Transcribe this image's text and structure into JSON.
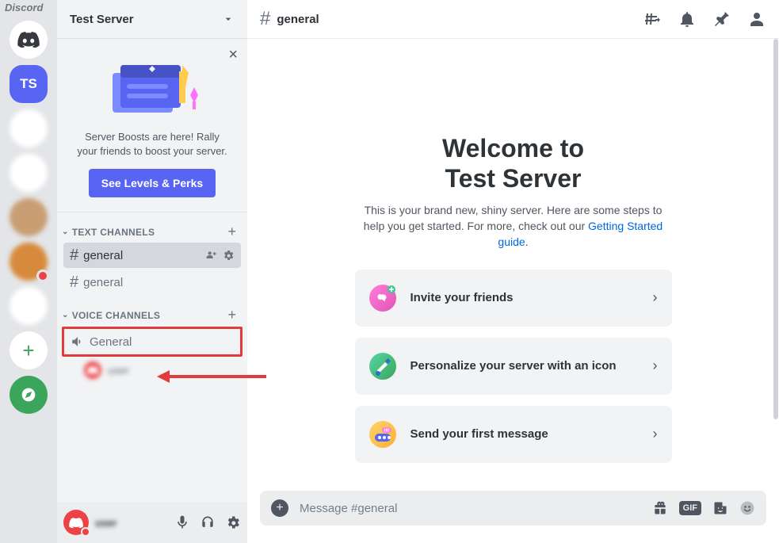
{
  "brand": "Discord",
  "rail": {
    "selected_initials": "TS"
  },
  "server": {
    "name": "Test Server"
  },
  "boost_card": {
    "text": "Server Boosts are here! Rally your friends to boost your server.",
    "button": "See Levels & Perks"
  },
  "categories": {
    "text": {
      "label": "TEXT CHANNELS",
      "channels": [
        {
          "name": "general",
          "active": true
        },
        {
          "name": "general",
          "active": false
        }
      ]
    },
    "voice": {
      "label": "VOICE CHANNELS",
      "channels": [
        {
          "name": "General"
        }
      ]
    }
  },
  "chat_header": {
    "channel": "general"
  },
  "welcome": {
    "line1": "Welcome to",
    "line2": "Test Server",
    "subtitle_a": "This is your brand new, shiny server. Here are some steps to help you get started. For more, check out our ",
    "subtitle_link": "Getting Started guide",
    "subtitle_b": ".",
    "steps": [
      {
        "label": "Invite your friends",
        "icon_bg": "#e255b4"
      },
      {
        "label": "Personalize your server with an icon",
        "icon_bg": "#3ba55c"
      },
      {
        "label": "Send your first message",
        "icon_bg": "#f7b132"
      }
    ]
  },
  "composer": {
    "placeholder": "Message #general"
  }
}
